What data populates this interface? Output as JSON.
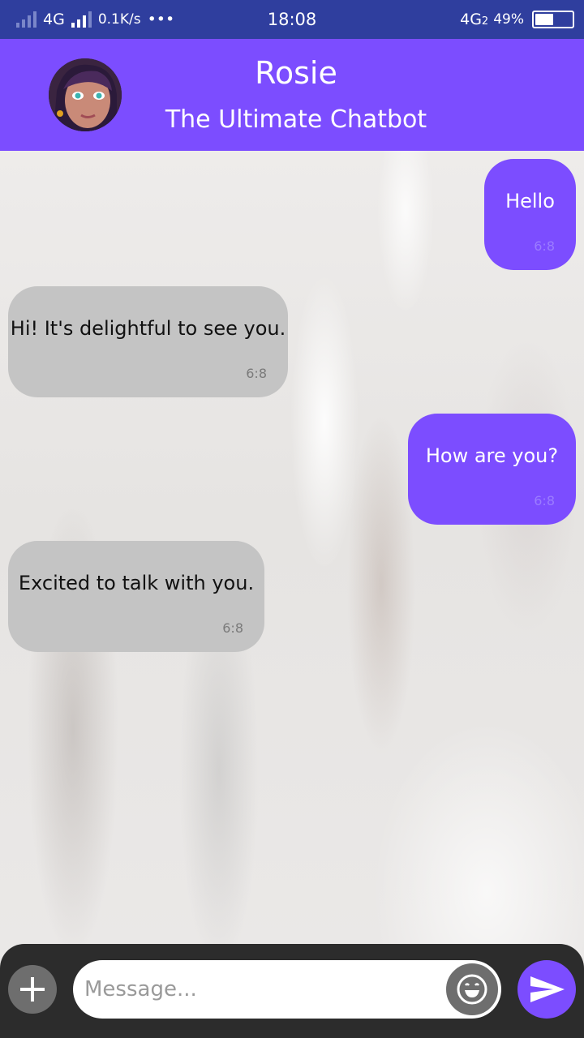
{
  "status_bar": {
    "network": "4G",
    "speed": "0.1K/s",
    "dots": "•••",
    "time": "18:08",
    "network2": "4G",
    "sim_index": "2",
    "battery_percent": "49%",
    "battery_level": 0.49
  },
  "header": {
    "title": "Rosie",
    "subtitle": "The Ultimate Chatbot",
    "avatar_icon": "avatar-portrait"
  },
  "messages": [
    {
      "direction": "outgoing",
      "text": "Hello",
      "time": "6:8"
    },
    {
      "direction": "incoming",
      "text": "Hi! It's delightful to see you.",
      "time": "6:8"
    },
    {
      "direction": "outgoing",
      "text": "How are you?",
      "time": "6:8"
    },
    {
      "direction": "incoming",
      "text": "Excited to talk with you.",
      "time": "6:8"
    }
  ],
  "input": {
    "placeholder": "Message...",
    "value": "",
    "add_icon": "plus-icon",
    "emoji_icon": "smiley-icon",
    "send_icon": "send-icon"
  },
  "colors": {
    "status_bar": "#2f3e9e",
    "accent": "#7c4dff",
    "incoming_bubble": "#c4c4c4",
    "input_bar": "#2c2c2c"
  }
}
